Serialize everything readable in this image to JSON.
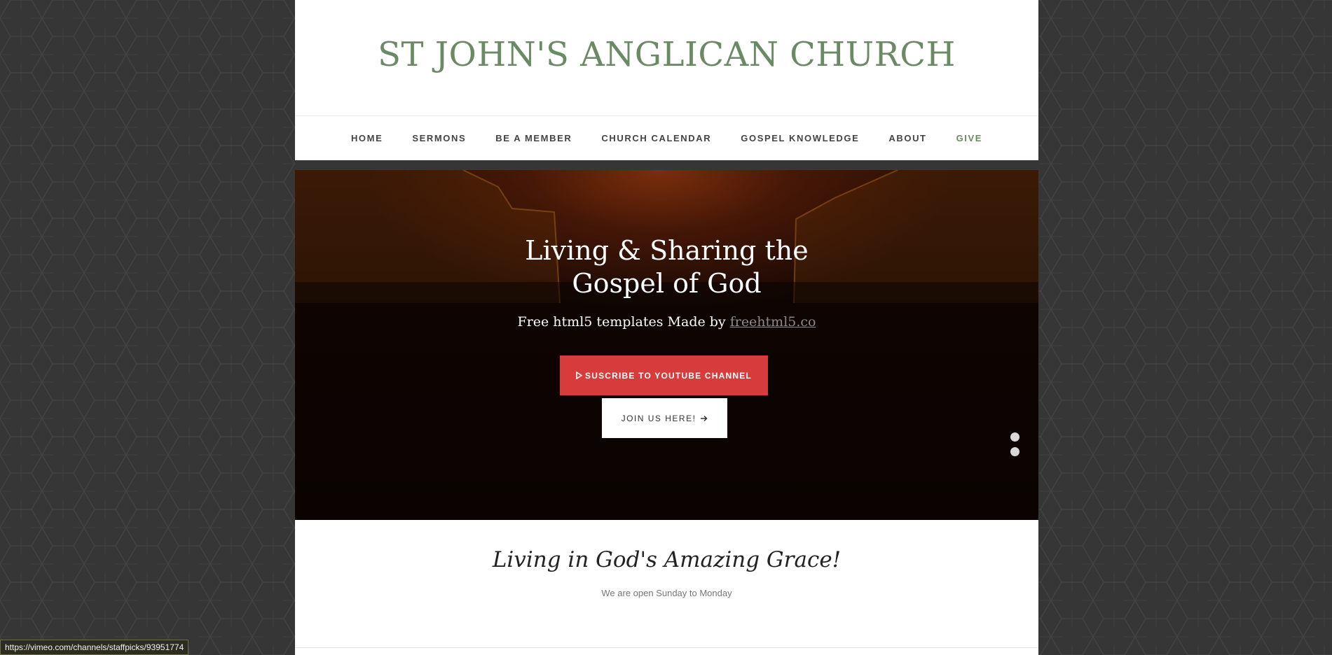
{
  "site": {
    "title": "ST JOHN'S ANGLICAN CHURCH"
  },
  "nav": {
    "items": [
      {
        "label": "HOME"
      },
      {
        "label": "SERMONS"
      },
      {
        "label": "BE A MEMBER"
      },
      {
        "label": "CHURCH CALENDAR"
      },
      {
        "label": "GOSPEL KNOWLEDGE"
      },
      {
        "label": "ABOUT"
      },
      {
        "label": "GIVE"
      }
    ],
    "active_item": "GIVE"
  },
  "hero": {
    "title_line1": "Living & Sharing the",
    "title_line2": "Gospel of God",
    "subtitle_prefix": "Free html5 templates Made by ",
    "subtitle_link": "freehtml5.co",
    "primary_button": {
      "icon": "play-icon",
      "label": "SUSCRIBE TO YOUTUBE CHANNEL"
    },
    "secondary_button": {
      "label": "JOIN US HERE!",
      "icon": "arrow-right-icon"
    },
    "slide_count": 2
  },
  "intro": {
    "title": "Living in God's Amazing Grace!",
    "subtitle": "We are open Sunday to Monday"
  },
  "status_bar": {
    "url": "https://vimeo.com/channels/staffpicks/93951774"
  },
  "colors": {
    "accent_green": "#6a8a64",
    "button_red": "#d73b3b",
    "background": "#363636"
  }
}
